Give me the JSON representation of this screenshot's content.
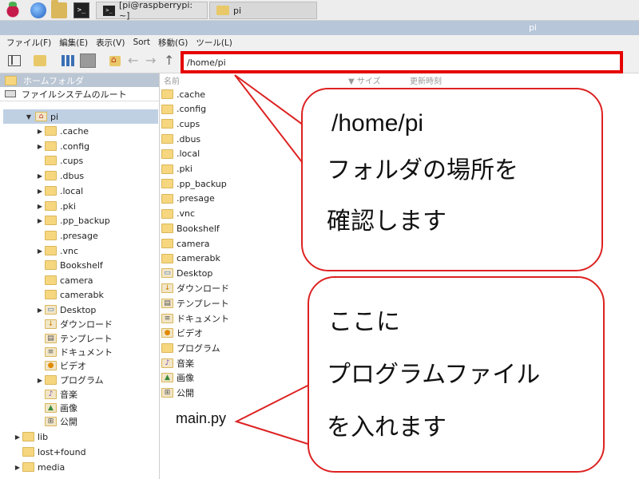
{
  "taskbar": {
    "task_terminal": "[pi@raspberrypi: ~]",
    "task_filemanager": "pi",
    "terminal_glyph": ">_"
  },
  "window": {
    "title": "pi"
  },
  "menu": [
    "ファイル(F)",
    "編集(E)",
    "表示(V)",
    "Sort",
    "移動(G)",
    "ツール(L)"
  ],
  "toolbar": {
    "back_glyph": "←",
    "forward_glyph": "→",
    "up_glyph": "↑",
    "path_value": "/home/pi"
  },
  "sidebar": {
    "header": "ホームフォルダ",
    "root": "ファイルシステムのルート",
    "tree": [
      {
        "label": "pi",
        "expander": "▼",
        "type": "home"
      },
      {
        "label": ".cache",
        "expander": "▶",
        "type": "folder"
      },
      {
        "label": ".config",
        "expander": "▶",
        "type": "folder"
      },
      {
        "label": ".cups",
        "expander": "",
        "type": "folder"
      },
      {
        "label": ".dbus",
        "expander": "▶",
        "type": "folder"
      },
      {
        "label": ".local",
        "expander": "▶",
        "type": "folder"
      },
      {
        "label": ".pki",
        "expander": "▶",
        "type": "folder"
      },
      {
        "label": ".pp_backup",
        "expander": "▶",
        "type": "folder"
      },
      {
        "label": ".presage",
        "expander": "",
        "type": "folder"
      },
      {
        "label": ".vnc",
        "expander": "▶",
        "type": "folder"
      },
      {
        "label": "Bookshelf",
        "expander": "",
        "type": "folder"
      },
      {
        "label": "camera",
        "expander": "",
        "type": "folder"
      },
      {
        "label": "camerabk",
        "expander": "",
        "type": "folder"
      },
      {
        "label": "Desktop",
        "expander": "▶",
        "type": "desktop"
      },
      {
        "label": "ダウンロード",
        "expander": "",
        "type": "download"
      },
      {
        "label": "テンプレート",
        "expander": "",
        "type": "template"
      },
      {
        "label": "ドキュメント",
        "expander": "",
        "type": "document"
      },
      {
        "label": "ビデオ",
        "expander": "",
        "type": "video"
      },
      {
        "label": "プログラム",
        "expander": "▶",
        "type": "folder"
      },
      {
        "label": "音楽",
        "expander": "",
        "type": "music"
      },
      {
        "label": "画像",
        "expander": "",
        "type": "picture"
      },
      {
        "label": "公開",
        "expander": "",
        "type": "public"
      },
      {
        "label": "lib",
        "expander": "▶",
        "type": "folder"
      },
      {
        "label": "lost+found",
        "expander": "",
        "type": "folder"
      },
      {
        "label": "media",
        "expander": "▶",
        "type": "folder"
      }
    ]
  },
  "list": {
    "col_name": "名前",
    "col_size": "▼ サイズ",
    "col_modified": "更新時刻",
    "files": [
      {
        "label": ".cache",
        "type": "folder"
      },
      {
        "label": ".config",
        "type": "folder"
      },
      {
        "label": ".cups",
        "type": "folder"
      },
      {
        "label": ".dbus",
        "type": "folder"
      },
      {
        "label": ".local",
        "type": "folder"
      },
      {
        "label": ".pki",
        "type": "folder"
      },
      {
        "label": ".pp_backup",
        "type": "folder"
      },
      {
        "label": ".presage",
        "type": "folder"
      },
      {
        "label": ".vnc",
        "type": "folder"
      },
      {
        "label": "Bookshelf",
        "type": "folder"
      },
      {
        "label": "camera",
        "type": "folder"
      },
      {
        "label": "camerabk",
        "type": "folder"
      },
      {
        "label": "Desktop",
        "type": "desktop"
      },
      {
        "label": "ダウンロード",
        "type": "download"
      },
      {
        "label": "テンプレート",
        "type": "template"
      },
      {
        "label": "ドキュメント",
        "type": "document"
      },
      {
        "label": "ビデオ",
        "type": "video"
      },
      {
        "label": "プログラム",
        "type": "folder"
      },
      {
        "label": "音楽",
        "type": "music"
      },
      {
        "label": "画像",
        "type": "picture"
      },
      {
        "label": "公開",
        "type": "public"
      }
    ],
    "main_file": "main.py"
  },
  "callout_path": {
    "line1": "/home/pi",
    "line2": "フォルダの場所を",
    "line3": "確認します"
  },
  "callout_program": {
    "line1": "ここに",
    "line2": "プログラムファイル",
    "line3": "を入れます"
  },
  "colors": {
    "highlight_border": "#e60000",
    "callout_border": "#dd2222",
    "selection": "#bfd0e3",
    "folder": "#f6d77f"
  }
}
